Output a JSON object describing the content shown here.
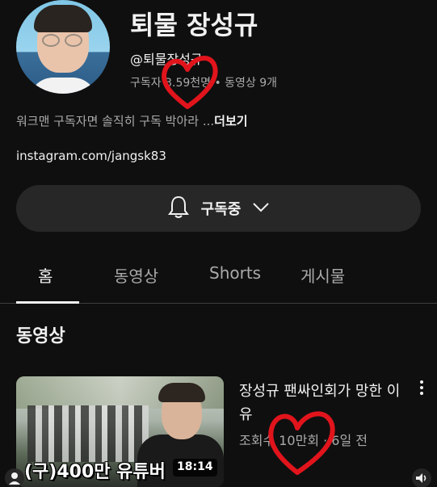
{
  "channel": {
    "name": "퇴물 장성규",
    "handle": "@퇴물장성규",
    "stats": "구독자 3.59천명 • 동영상 9개",
    "description": "워크맨 구독자면 솔직히 구독 박아라 ...",
    "description_more": "더보기",
    "link": "instagram.com/jangsk83"
  },
  "subscribe": {
    "label": "구독중",
    "bell_icon": "bell-icon",
    "chevron_icon": "chevron-down-icon"
  },
  "tabs": [
    {
      "label": "홈",
      "active": true
    },
    {
      "label": "동영상",
      "active": false
    },
    {
      "label": "Shorts",
      "active": false
    },
    {
      "label": "게시물",
      "active": false
    }
  ],
  "section": {
    "title": "동영상"
  },
  "video": {
    "title": "장성규 팬싸인회가 망한 이유",
    "meta": "조회수 10만회 · 6일 전",
    "duration": "18:14",
    "thumbnail_text": "(구)400만 유튜버 ",
    "more_icon": "more-vert-icon"
  },
  "annotations": {
    "heart_color": "#e1141c"
  }
}
